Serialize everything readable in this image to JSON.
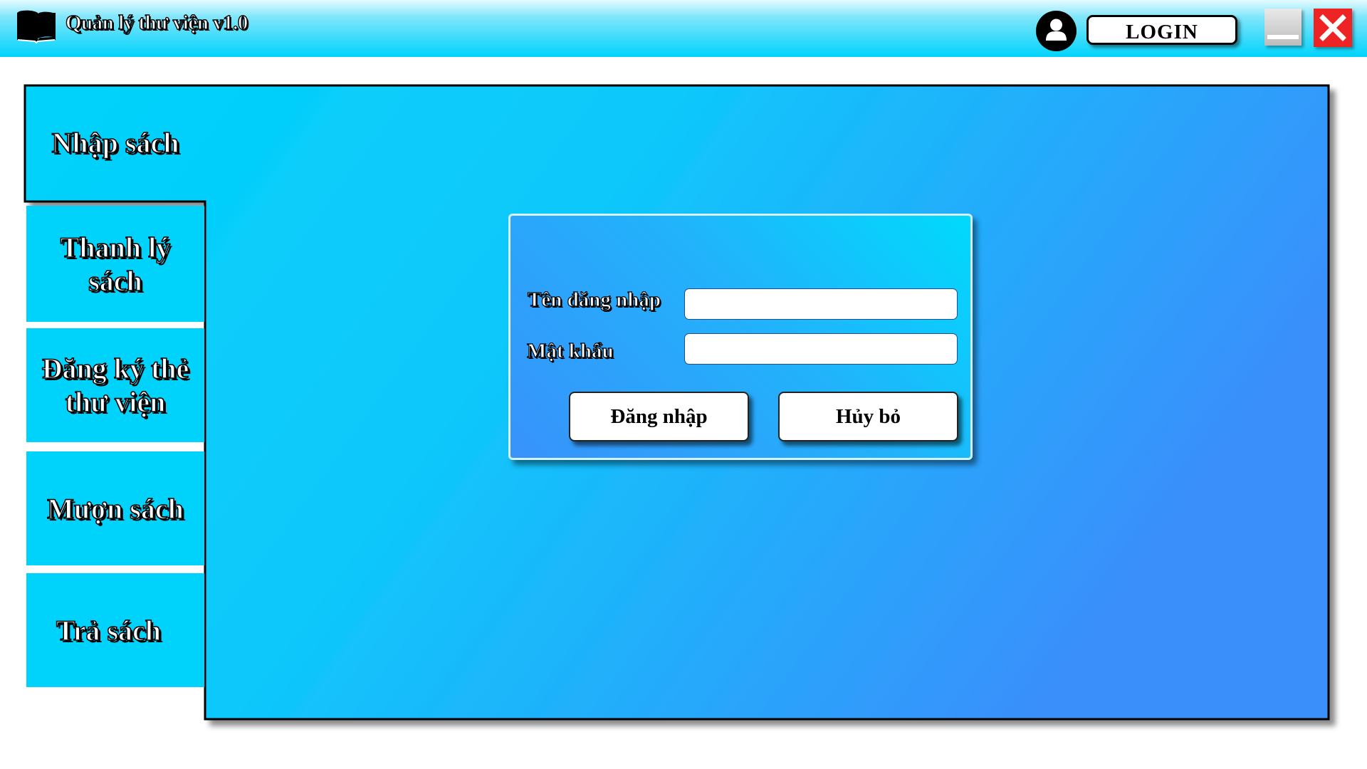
{
  "window": {
    "title": "Quản lý thư viện v1.0",
    "icons": {
      "app": "book-icon",
      "user": "user-icon",
      "minimize": "minimize-icon",
      "close": "close-icon"
    }
  },
  "header": {
    "login_label": "LOGIN"
  },
  "sidebar": {
    "items": [
      {
        "label": "Nhập sách"
      },
      {
        "label": "Thanh lý sách"
      },
      {
        "label": "Đăng ký thẻ thư viện"
      },
      {
        "label": "Mượn sách"
      },
      {
        "label": "Trả sách"
      }
    ]
  },
  "login_form": {
    "username_label": "Tên đăng nhập",
    "username_value": "",
    "password_label": "Mật khẩu",
    "password_value": "",
    "login_button": "Đăng nhập",
    "cancel_button": "Hủy bỏ"
  },
  "colors": {
    "accent_cyan": "#00d3fb",
    "accent_blue": "#3892fb",
    "close_red": "#ee2424"
  }
}
